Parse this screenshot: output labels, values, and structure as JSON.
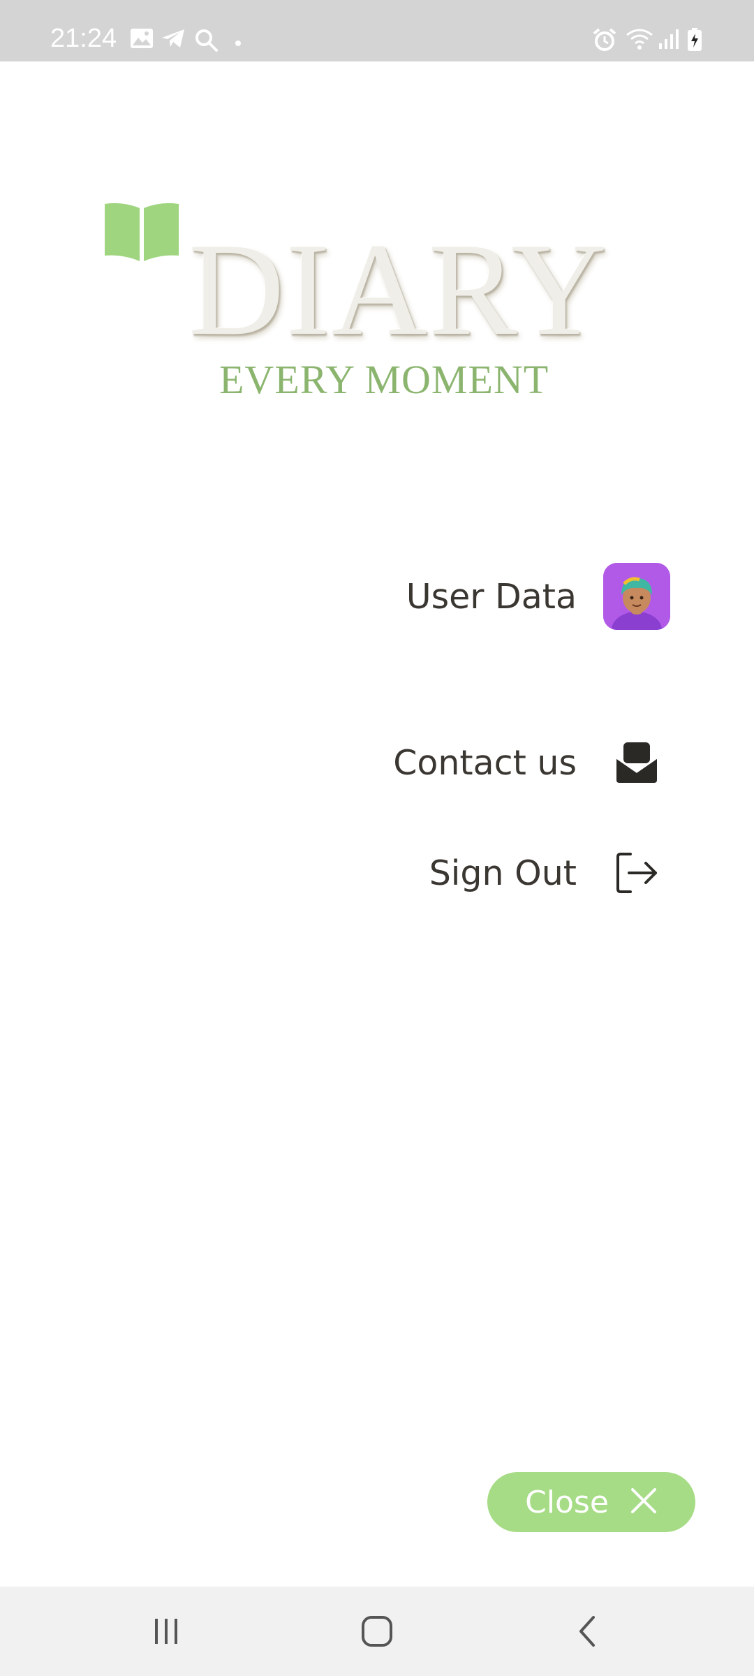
{
  "status_bar": {
    "time": "21:24",
    "left_icons": [
      "image-icon",
      "telegram-icon",
      "search-icon",
      "dot-icon"
    ],
    "right_icons": [
      "alarm-icon",
      "wifi-icon",
      "signal-icon",
      "battery-charging-icon"
    ]
  },
  "logo": {
    "title": "DIARY",
    "subtitle": "EVERY MOMENT",
    "icon": "book-icon",
    "colors": {
      "accent_green": "#8bb56f",
      "book_green": "#9ed57e"
    }
  },
  "menu": {
    "items": [
      {
        "label": "User Data",
        "icon": "user-avatar-icon"
      },
      {
        "label": "Contact us",
        "icon": "open-envelope-icon"
      },
      {
        "label": "Sign Out",
        "icon": "sign-out-icon"
      }
    ]
  },
  "close_button": {
    "label": "Close",
    "icon": "close-icon",
    "color": "#a6dc85"
  },
  "nav_bar": {
    "buttons": [
      "recent-apps-icon",
      "home-icon",
      "back-icon"
    ]
  }
}
